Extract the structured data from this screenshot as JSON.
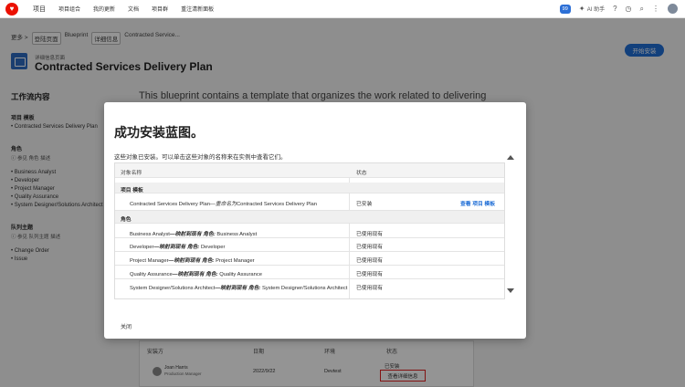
{
  "topbar": {
    "logo": "♥",
    "nav": [
      "项目",
      "项目组合",
      "我的更新",
      "文档",
      "项目群",
      "重注清新面板"
    ],
    "badge": "99",
    "ai_label": "AI 助手",
    "icons": [
      "question-icon",
      "history-icon",
      "search-icon",
      "grid-icon"
    ]
  },
  "breadcrumb": {
    "more": "更多 >",
    "items": [
      "登陆页面",
      "Blueprint",
      "详细信息",
      "Contracted Service..."
    ]
  },
  "page": {
    "kind": "详细信息页面",
    "title": "Contracted Services Delivery Plan",
    "install_button": "开始安装",
    "blueprint_text": "This blueprint contains a template that organizes the work related to delivering"
  },
  "sidebar": {
    "title": "工作流内容",
    "template_heading": "项目 模板",
    "template_item": "• Contracted Services Delivery Plan",
    "roles_heading": "角色",
    "roles_sub": "ⓘ 参见 角色 描述",
    "roles": [
      "Business Analyst",
      "Developer",
      "Project Manager",
      "Quality Assurance",
      "System Designer/Solutions Architect"
    ],
    "queue_heading": "队列主题",
    "queue_sub": "ⓘ 参见 队列主题 描述",
    "queue_items": [
      "Change Order",
      "Issue"
    ]
  },
  "background_table": {
    "headers": [
      "安装方",
      "日期",
      "环境",
      "状态"
    ],
    "user_name": "Joan Harris",
    "user_role": "Production Manager",
    "date": "2022/9/22",
    "env": "Devtest",
    "status": "已安装",
    "details_button": "查看详细信息"
  },
  "modal": {
    "title": "成功安装蓝图。",
    "description": "这些对象已安装。可以单击这些对象的名称来在实例中查看它们。",
    "col_name": "对象名称",
    "col_status": "状态",
    "template_section": "项目 模板",
    "template_row": {
      "name_start": "Contracted Services Delivery Plan",
      "name_mid": "—重命名为",
      "name_end": "Contracted Services Delivery Plan",
      "status": "已安装",
      "link": "查看 项目 模板"
    },
    "roles_section": "角色",
    "role_rows": [
      {
        "a": "Business Analyst",
        "m": "—映射到现有 角色:",
        "b": " Business Analyst",
        "status": "已使用现有"
      },
      {
        "a": "Developer",
        "m": "—映射到现有 角色:",
        "b": " Developer",
        "status": "已使用现有"
      },
      {
        "a": "Project Manager",
        "m": "—映射到现有 角色:",
        "b": " Project Manager",
        "status": "已使用现有"
      },
      {
        "a": "Quality Assurance",
        "m": "—映射到现有 角色:",
        "b": " Quality Assurance",
        "status": "已使用现有"
      },
      {
        "a": "System Designer/Solutions Architect",
        "m": "—映射到现有 角色:",
        "b": " System Designer/Solutions Architect",
        "status": "已使用现有"
      }
    ],
    "close_label": "关闭"
  }
}
